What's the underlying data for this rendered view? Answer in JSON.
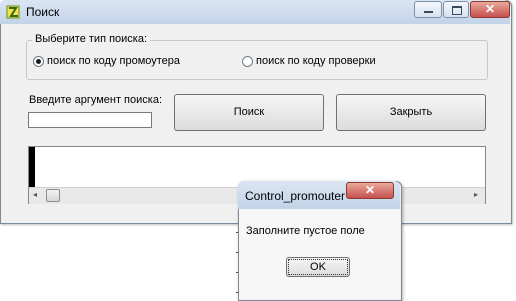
{
  "window": {
    "title": "Поиск",
    "close_glyph": "✕"
  },
  "search_type": {
    "legend": "Выберите тип поиска:",
    "options": [
      {
        "label": "поиск по коду промоутера",
        "selected": true
      },
      {
        "label": "поиск по коду проверки",
        "selected": false
      }
    ]
  },
  "search_arg": {
    "label": "Введите аргумент поиска:",
    "value": ""
  },
  "buttons": {
    "search": "Поиск",
    "close": "Закрыть"
  },
  "scrollbar": {
    "left_arrow": "◂",
    "right_arrow": "▸"
  },
  "message_box": {
    "title": "Control_promouter",
    "close_glyph": "✕",
    "message": "Заполните пустое поле",
    "ok_label": "OK"
  }
}
